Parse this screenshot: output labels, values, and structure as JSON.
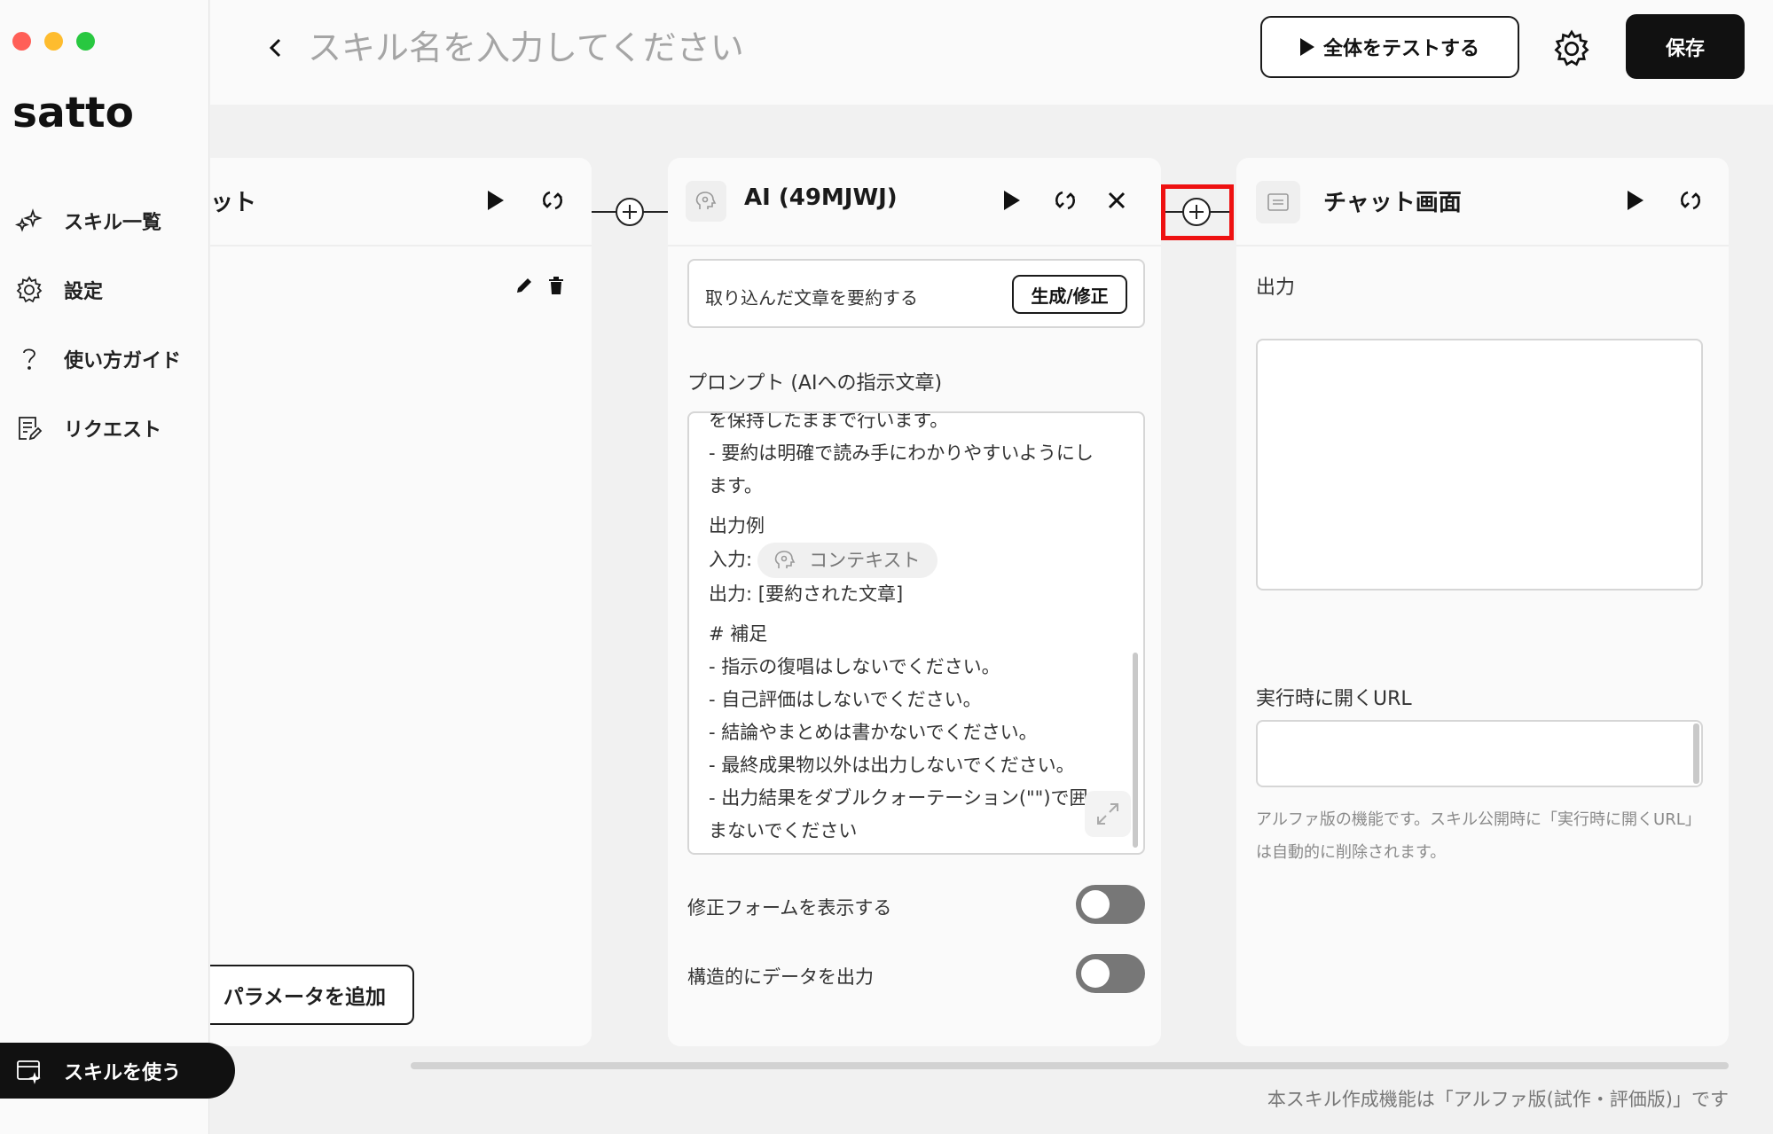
{
  "window": {
    "controls": [
      "close",
      "minimize",
      "zoom"
    ]
  },
  "sidebar": {
    "logo": "satto",
    "items": [
      {
        "label": "スキル一覧",
        "icon": "sparkles-icon"
      },
      {
        "label": "設定",
        "icon": "gear-icon"
      },
      {
        "label": "使い方ガイド",
        "icon": "question-icon"
      },
      {
        "label": "リクエスト",
        "icon": "request-icon"
      }
    ],
    "use_skill": "スキルを使う"
  },
  "header": {
    "name_placeholder": "スキル名を入力してください",
    "test_all": "全体をテストする",
    "save": "保存"
  },
  "cards": {
    "input": {
      "title_partial": "ット",
      "add_param": "パラメータを追加"
    },
    "ai": {
      "title": "AI (49MJWJ)",
      "summary_text": "取り込んだ文章を要約する",
      "generate_button": "生成/修正",
      "prompt_label": "プロンプト (AIへの指示文章)",
      "prompt_lines": {
        "l0": "を保持したままで行います。",
        "l1": "- 要約は明確で読み手にわかりやすいようにし",
        "l2": "ます。",
        "l3": "出力例",
        "l4_prefix": "入力:",
        "l4_chip": "コンテキスト",
        "l5": "出力: [要約された文章]",
        "l6": "# 補足",
        "l7": "- 指示の復唱はしないでください。",
        "l8": "- 自己評価はしないでください。",
        "l9": "- 結論やまとめは書かないでください。",
        "l10": "- 最終成果物以外は出力しないでください。",
        "l11": "- 出力結果をダブルクォーテーション(\"\")で囲",
        "l12": "まないでください"
      },
      "toggle_form_label": "修正フォームを表示する",
      "toggle_structured_label": "構造的にデータを出力",
      "toggle_form_on": false,
      "toggle_structured_on": false
    },
    "chat": {
      "title": "チャット画面",
      "output_label": "出力",
      "url_label": "実行時に開くURL",
      "url_value": "",
      "note": "アルファ版の機能です。スキル公開時に「実行時に開くURL」は自動的に削除されます。"
    }
  },
  "footer": {
    "alpha_note": "本スキル作成機能は「アルファ版(試作・評価版)」です"
  },
  "colors": {
    "highlight": "#ee1111",
    "primary": "#111111",
    "toggle_off": "#777777"
  }
}
